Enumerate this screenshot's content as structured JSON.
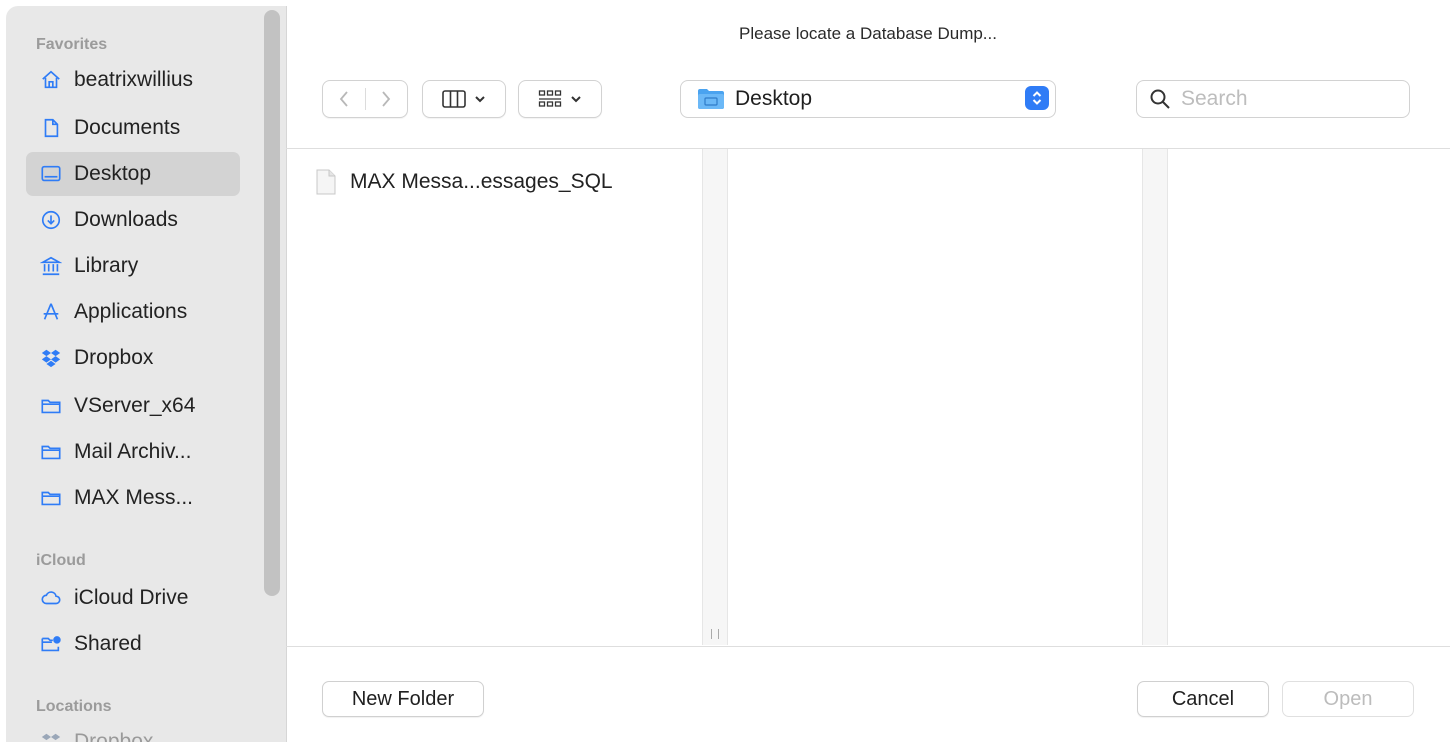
{
  "dialog": {
    "title": "Please locate a Database Dump..."
  },
  "sidebar": {
    "favorites_heading": "Favorites",
    "favorites": [
      {
        "label": "beatrixwillius",
        "icon": "home-icon"
      },
      {
        "label": "Documents",
        "icon": "document-icon"
      },
      {
        "label": "Desktop",
        "icon": "desktop-icon",
        "selected": true
      },
      {
        "label": "Downloads",
        "icon": "download-icon"
      },
      {
        "label": "Library",
        "icon": "library-icon"
      },
      {
        "label": "Applications",
        "icon": "applications-icon"
      },
      {
        "label": "Dropbox",
        "icon": "dropbox-icon"
      },
      {
        "label": "VServer_x64",
        "icon": "folder-icon"
      },
      {
        "label": "Mail Archiv...",
        "icon": "folder-icon"
      },
      {
        "label": "MAX Mess...",
        "icon": "folder-icon"
      }
    ],
    "icloud_heading": "iCloud",
    "icloud": [
      {
        "label": "iCloud Drive",
        "icon": "cloud-icon"
      },
      {
        "label": "Shared",
        "icon": "shared-folder-icon"
      }
    ],
    "locations_heading": "Locations",
    "locations": [
      {
        "label": "Dropbox",
        "icon": "dropbox-icon"
      }
    ]
  },
  "toolbar": {
    "location": "Desktop",
    "search_placeholder": "Search"
  },
  "browser": {
    "files": [
      {
        "name": "MAX Messa...essages_SQL",
        "icon": "file-icon"
      }
    ]
  },
  "footer": {
    "new_folder_label": "New Folder",
    "cancel_label": "Cancel",
    "open_label": "Open",
    "open_enabled": false
  },
  "colors": {
    "accent": "#2f7cf6",
    "sidebar_bg": "#e8e8e8",
    "selected_bg": "#d3d3d3"
  }
}
